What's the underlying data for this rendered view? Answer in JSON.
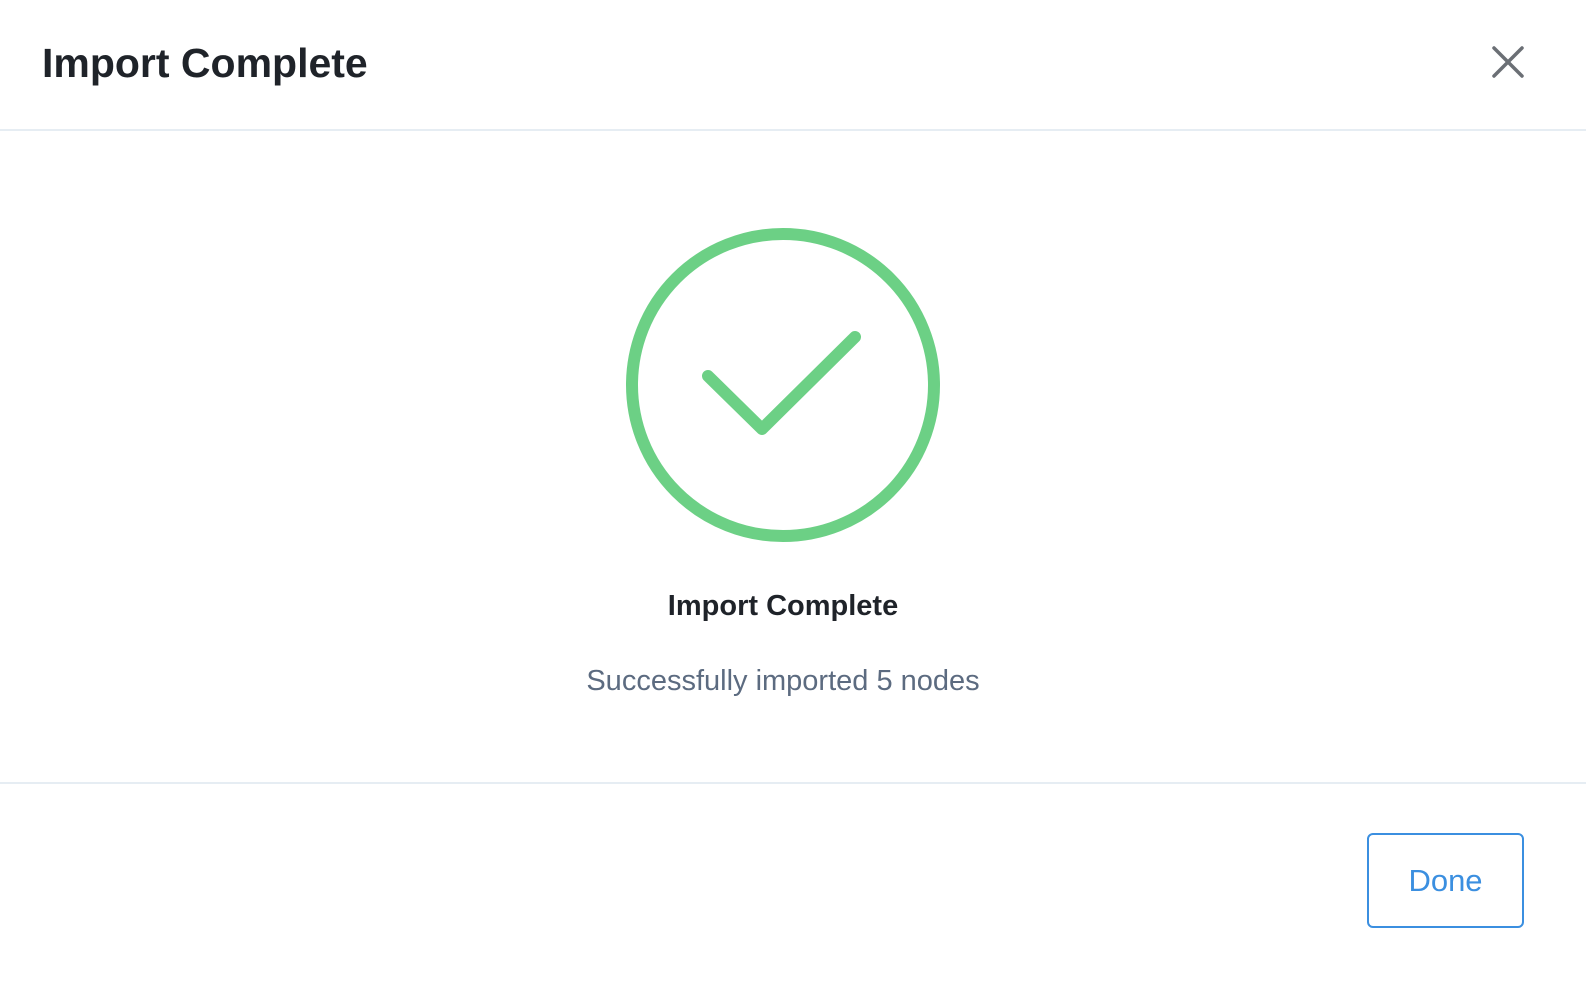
{
  "dialog": {
    "title": "Import Complete",
    "close_icon": "close-icon"
  },
  "result": {
    "icon": "check-circle-icon",
    "status_title": "Import Complete",
    "status_message": "Successfully imported 5 nodes"
  },
  "footer": {
    "done_label": "Done"
  },
  "colors": {
    "success": "#6cd085",
    "accent": "#3b8fe0",
    "title_text": "#1f2329",
    "muted_text": "#5c6b80",
    "divider": "#e6edf3",
    "close_icon": "#6b6f75"
  }
}
